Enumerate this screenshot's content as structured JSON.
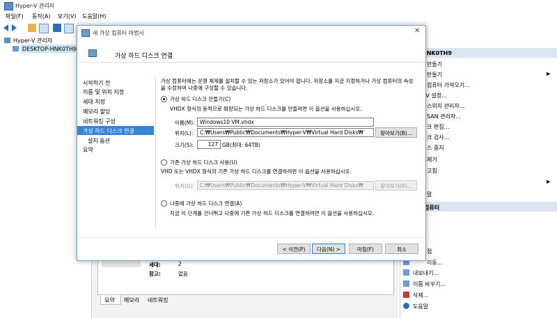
{
  "window": {
    "title": "Hyper-V 관리자"
  },
  "menu": [
    "파일(F)",
    "동작(A)",
    "보기(V)",
    "도움말(H)"
  ],
  "tree": {
    "root": "Hyper-V 관리자",
    "host": "DESKTOP-HNK0TH9"
  },
  "center": {
    "detail_labels": [
      "세대:",
      "참고:"
    ],
    "detail_values": [
      "2",
      "없음"
    ],
    "tabs": [
      "요약",
      "메모리",
      "네트워킹"
    ]
  },
  "actions": {
    "header_host": "P-HNK0TH9",
    "items_top": [
      "만들기",
      "만들기",
      "컴퓨터 가져오기...",
      "-V 설정...",
      "스위치 관리자...",
      "SAN 관리자...",
      "크 편집...",
      "크 검사...",
      "스 중지",
      "제거",
      "고침",
      "",
      "말"
    ],
    "header_vm": "컴퓨터",
    "items_bottom": [
      "점",
      "이동...",
      "내보내기...",
      "이름 바꾸기...",
      "삭제...",
      "도움말"
    ]
  },
  "dialog": {
    "title": "새 가상 컴퓨터 마법사",
    "heading": "가상 하드 디스크 연결",
    "nav": [
      "시작하기 전",
      "이름 및 위치 지정",
      "세대 지정",
      "메모리 할당",
      "네트워킹 구성",
      "가상 하드 디스크 연결",
      "설치 옵션",
      "요약"
    ],
    "nav_active_index": 5,
    "intro_line1": "가상 컴퓨터에는 운영 체제를 설치할 수 있는 저장소가 있어야 합니다. 저장소를 지금 지정하거나 가상 컴퓨터의 속성",
    "intro_line2": "을 수정하여 나중에 구성할 수 있습니다.",
    "opt1_label": "가상 하드 디스크 만들기(C)",
    "opt1_desc": "VHDX 형식의 동적으로 확장되는 가상 하드 디스크를 만들려면 이 옵션을 사용하십시오.",
    "name_label": "이름(M):",
    "name_value": "Windows10 VM.vhdx",
    "location_label": "위치(L):",
    "location_value": "C:₩Users₩Public₩Documents₩Hyper-V₩Virtual Hard Disks₩",
    "browse1": "찾아보기(B)...",
    "size_label": "크기(S):",
    "size_value": "127",
    "size_unit": "GB(최대: 64TB)",
    "opt2_label": "기존 가상 하드 디스크 사용(U)",
    "opt2_desc": "VHD 또는 VHDX 형식의 기존 가상 하드 디스크를 연결하려면 이 옵션을 사용하십시오.",
    "location2_label": "위치(O):",
    "location2_value": "C:₩Users₩Public₩Documents₩Hyper-V₩Virtual Hard Disks₩",
    "browse2": "찾아보기(R)...",
    "opt3_label": "나중에 가상 하드 디스크 연결(A)",
    "opt3_desc": "지금 이 단계를 건너뛰고 나중에 기존 가상 하드 디스크를 연결하려면 이 옵션을 사용하십시오.",
    "buttons": {
      "prev": "< 이전(P)",
      "next": "다음(N) >",
      "finish": "마침(F)",
      "cancel": "취소"
    }
  },
  "colors": {
    "accent": "#3584d6",
    "header_band": "#dbe4f1"
  }
}
